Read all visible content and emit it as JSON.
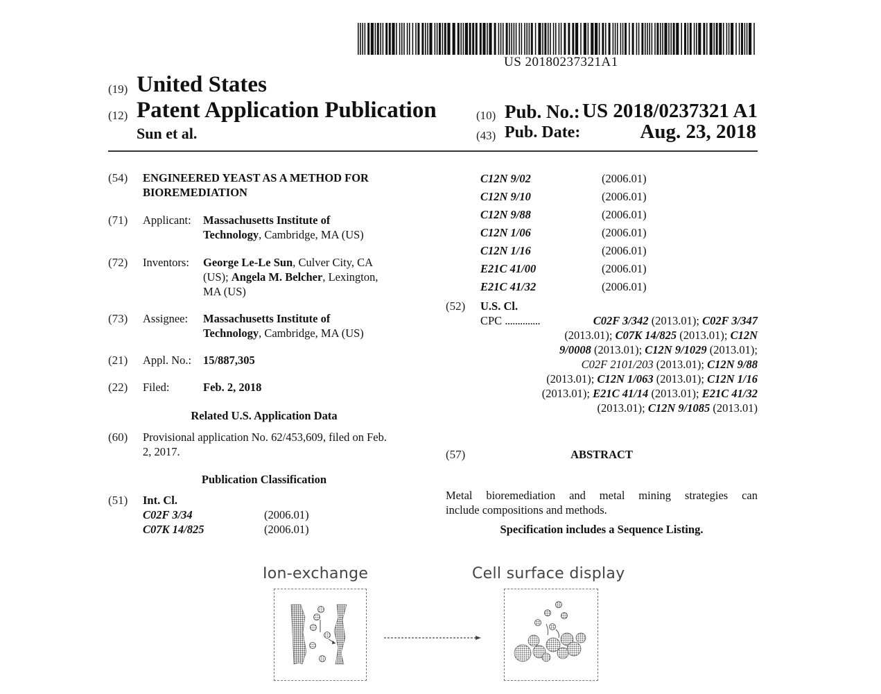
{
  "barcode_number": "US 20180237321A1",
  "header": {
    "code19": "(19)",
    "country": "United States",
    "code12": "(12)",
    "doc_type": "Patent Application Publication",
    "authors": "Sun et al.",
    "code10": "(10)",
    "pub_no_label": "Pub. No.:",
    "pub_no": "US 2018/0237321 A1",
    "code43": "(43)",
    "pub_date_label": "Pub. Date:",
    "pub_date": "Aug. 23, 2018"
  },
  "left": {
    "f54": {
      "code": "(54)",
      "line1": "ENGINEERED YEAST AS A METHOD FOR",
      "line2": "BIOREMEDIATION"
    },
    "f71": {
      "code": "(71)",
      "label": "Applicant:",
      "l1_bold": "Massachusetts Institute of",
      "l2_bold": "Technology",
      "l2_rest": ", Cambridge, MA (US)"
    },
    "f72": {
      "code": "(72)",
      "label": "Inventors:",
      "l1_bold": "George Le-Le Sun",
      "l1_rest": ", Culver City, CA",
      "l2_pre": "(US); ",
      "l2_bold": "Angela M. Belcher",
      "l2_rest": ", Lexington,",
      "l3": "MA (US)"
    },
    "f73": {
      "code": "(73)",
      "label": "Assignee:",
      "l1_bold": "Massachusetts Institute of",
      "l2_bold": "Technology",
      "l2_rest": ", Cambridge, MA (US)"
    },
    "f21": {
      "code": "(21)",
      "label": "Appl. No.:",
      "value": "15/887,305"
    },
    "f22": {
      "code": "(22)",
      "label": "Filed:",
      "value": "Feb. 2, 2018"
    },
    "related_heading": "Related U.S. Application Data",
    "f60": {
      "code": "(60)",
      "line1": "Provisional application No. 62/453,609, filed on Feb.",
      "line2": "2, 2017."
    },
    "pubclass_heading": "Publication Classification",
    "f51": {
      "code": "(51)",
      "label": "Int. Cl.",
      "entries": [
        {
          "cls": "C02F 3/34",
          "ver": "(2006.01)"
        },
        {
          "cls": "C07K 14/825",
          "ver": "(2006.01)"
        }
      ]
    }
  },
  "right": {
    "int_cl_cont": [
      {
        "cls": "C12N 9/02",
        "ver": "(2006.01)"
      },
      {
        "cls": "C12N 9/10",
        "ver": "(2006.01)"
      },
      {
        "cls": "C12N 9/88",
        "ver": "(2006.01)"
      },
      {
        "cls": "C12N 1/06",
        "ver": "(2006.01)"
      },
      {
        "cls": "C12N 1/16",
        "ver": "(2006.01)"
      },
      {
        "cls": "E21C 41/00",
        "ver": "(2006.01)"
      },
      {
        "cls": "E21C 41/32",
        "ver": "(2006.01)"
      }
    ],
    "f52": {
      "code": "(52)",
      "label": "U.S. Cl.",
      "cpc_label": "CPC",
      "cpc_dots": "..............",
      "lines": [
        [
          "C02F 3/342",
          " (2013.01); ",
          "C02F 3/347"
        ],
        [
          "(2013.01); ",
          "C07K 14/825",
          " (2013.01); ",
          "C12N"
        ],
        [
          "9/0008",
          " (2013.01); ",
          "C12N 9/1029",
          " (2013.01);"
        ],
        [
          "C02F 2101/203",
          " (2013.01); ",
          "C12N 9/88"
        ],
        [
          "(2013.01); ",
          "C12N 1/063",
          " (2013.01); ",
          "C12N 1/16"
        ],
        [
          "(2013.01); ",
          "E21C 41/14",
          " (2013.01); ",
          "E21C 41/32"
        ],
        [
          "(2013.01); ",
          "C12N 9/1085",
          " (2013.01)"
        ]
      ]
    },
    "f57": {
      "code": "(57)",
      "label": "ABSTRACT"
    },
    "abstract_line1": "Metal bioremediation and metal mining strategies can",
    "abstract_line2": "include compositions and methods.",
    "seq_listing": "Specification includes a Sequence Listing."
  },
  "figure": {
    "left_title": "Ion-exchange",
    "right_title": "Cell surface display"
  }
}
